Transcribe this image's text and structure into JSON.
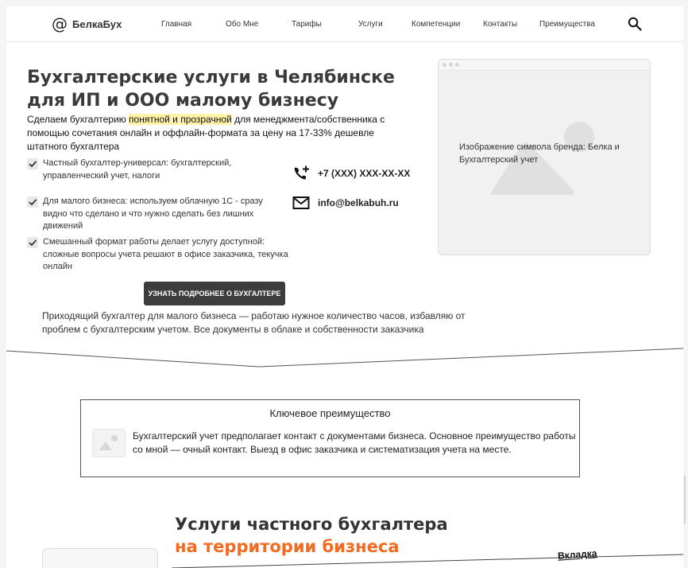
{
  "header": {
    "logo_text": "БелкаБух",
    "nav": [
      "Главная",
      "Обо Мне",
      "Тарифы",
      "Услуги",
      "Компетенции",
      "Контакты",
      "Преимущества"
    ]
  },
  "hero": {
    "title": "Бухгалтерские услуги в Челябинске для ИП и ООО малому бизнесу",
    "subtitle_pre": "Сделаем бухгалтерию ",
    "subtitle_highlight": "понятной и прозрачной",
    "subtitle_post": " для менеджмента/собственника с помощью сочетания онлайн и оффлайн-формата за цену на 17-33% дешевле штатного бухгалтера",
    "checks": [
      "Частный бухгалтер-универсал: бухгалтерский, управленческий учет, налоги",
      "Для малого бизнеса: используем облачную 1С - сразу видно что сделано и что нужно сделать без лишних движений",
      "Смешанный формат работы делает услугу доступной: сложные вопросы учета решают в офисе заказчика, текучка онлайн"
    ],
    "phone": "+7 (XXX) XXX-XX-XX",
    "email": "info@belkabuh.ru",
    "cta_label": "УЗНАТЬ ПОДРОБНЕЕ О БУХГАЛТЕРЕ",
    "note": "Приходящий бухгалтер для малого бизнеса — работаю нужное количество часов, избавляю от проблем с бухгалтерским учетом. Все документы в облаке и собственности заказчика",
    "image_caption": "Изображение символа бренда: Белка и Бухгалтерский учет"
  },
  "advantage": {
    "title": "Ключевое преимущество",
    "text": "Бухгалтерский учет предполагает контакт с документами бизнеса. Основное преимущество работы со мной — очный контакт. Выезд в офис заказчика и систематизация учета на месте."
  },
  "services": {
    "title_part1": "Услуги ",
    "title_part2": "частного бухгалтера ",
    "title_part3": "на территории бизнеса",
    "tab_label": "Вкладка"
  },
  "colors": {
    "accent": "#f26b21",
    "highlight": "#fff3a8",
    "button": "#3d3d3d"
  }
}
